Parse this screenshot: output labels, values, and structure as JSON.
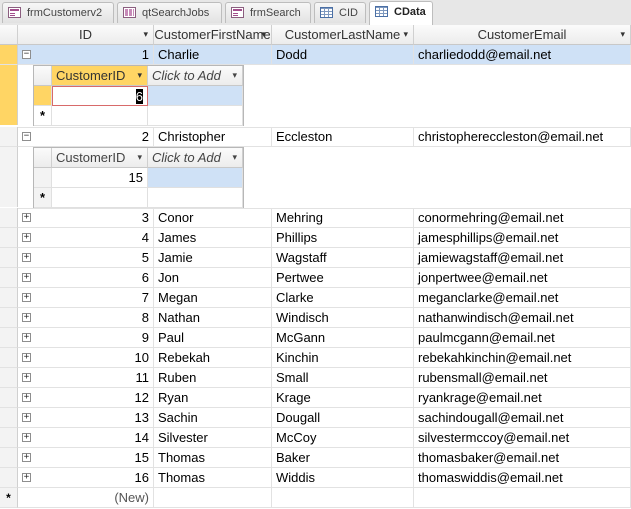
{
  "tabs": [
    {
      "label": "frmCustomerv2",
      "icon": "form-icon"
    },
    {
      "label": "qtSearchJobs",
      "icon": "query-icon"
    },
    {
      "label": "frmSearch",
      "icon": "form-icon"
    },
    {
      "label": "CID",
      "icon": "table-icon"
    },
    {
      "label": "CData",
      "icon": "table-icon"
    }
  ],
  "columns": {
    "id": "ID",
    "first": "CustomerFirstName",
    "last": "CustomerLastName",
    "email": "CustomerEmail"
  },
  "rows": [
    {
      "id": "1",
      "first": "Charlie",
      "last": "Dodd",
      "email": "charliedodd@email.net"
    },
    {
      "id": "2",
      "first": "Christopher",
      "last": "Eccleston",
      "email": "christophereccleston@email.net"
    },
    {
      "id": "3",
      "first": "Conor",
      "last": "Mehring",
      "email": "conormehring@email.net"
    },
    {
      "id": "4",
      "first": "James",
      "last": "Phillips",
      "email": "jamesphillips@email.net"
    },
    {
      "id": "5",
      "first": "Jamie",
      "last": "Wagstaff",
      "email": "jamiewagstaff@email.net"
    },
    {
      "id": "6",
      "first": "Jon",
      "last": "Pertwee",
      "email": "jonpertwee@email.net"
    },
    {
      "id": "7",
      "first": "Megan",
      "last": "Clarke",
      "email": "meganclarke@email.net"
    },
    {
      "id": "8",
      "first": "Nathan",
      "last": "Windisch",
      "email": "nathanwindisch@email.net"
    },
    {
      "id": "9",
      "first": "Paul",
      "last": "McGann",
      "email": "paulmcgann@email.net"
    },
    {
      "id": "10",
      "first": "Rebekah",
      "last": "Kinchin",
      "email": "rebekahkinchin@email.net"
    },
    {
      "id": "11",
      "first": "Ruben",
      "last": "Small",
      "email": "rubensmall@email.net"
    },
    {
      "id": "12",
      "first": "Ryan",
      "last": "Krage",
      "email": "ryankrage@email.net"
    },
    {
      "id": "13",
      "first": "Sachin",
      "last": "Dougall",
      "email": "sachindougall@email.net"
    },
    {
      "id": "14",
      "first": "Silvester",
      "last": "McCoy",
      "email": "silvestermccoy@email.net"
    },
    {
      "id": "15",
      "first": "Thomas",
      "last": "Baker",
      "email": "thomasbaker@email.net"
    },
    {
      "id": "16",
      "first": "Thomas",
      "last": "Widdis",
      "email": "thomaswiddis@email.net"
    }
  ],
  "subdatasheets": [
    {
      "col1": "CustomerID",
      "col2": "Click to Add",
      "value": "6"
    },
    {
      "col1": "CustomerID",
      "col2": "Click to Add",
      "value": "15"
    }
  ],
  "new_row_label": "(New)",
  "expand_symbol": "+",
  "collapse_symbol": "−",
  "new_record_symbol": "*",
  "colors": {
    "selected_row": "#cfe1f6",
    "active_selector": "#ffd564",
    "header_yellow": "#ffd564"
  }
}
